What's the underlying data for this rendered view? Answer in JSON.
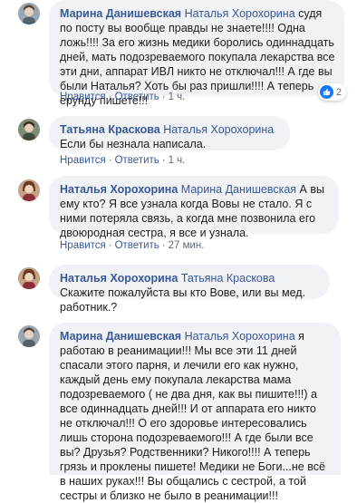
{
  "actions": {
    "like": "Нравится",
    "reply": "Ответить",
    "dot": "·"
  },
  "comments": [
    {
      "author": "Марина Данишевская",
      "mention": "Наталья Хорохорина",
      "text": " судя по посту вы вообще правды не знаете!!!! Одна ложь!!!! За его жизнь медики боролись одиннадцать дней, мать подозреваемого покупала лекарства все эти дни, аппарат ИВЛ никто не отключал!!! А где вы были Наталья? Хоть бы раз пришли!!!! А теперь ерунду пишете!!!",
      "time": "1 ч.",
      "reactions_count": "2",
      "avatar_color": "#8a9ba8"
    },
    {
      "author": "Татьяна Краскова",
      "mention": "Наталья Хорохорина",
      "text": " Если бы незнала написала.",
      "time": "1 ч.",
      "avatar_color": "#6f7f6a"
    },
    {
      "author": "Наталья Хорохорина",
      "mention": "Марина Данишевская",
      "text": " А вы ему кто? Я все узнала когда Вовы не стало. Я с ними потеряла связь, а когда мне позвонила его двоюродная сестра, я все и узнала.",
      "time": "27 мин.",
      "avatar_color": "#a3744f"
    },
    {
      "author": "Наталья Хорохорина",
      "mention": "Татьяна Краскова",
      "text": " Скажите пожалуйста вы кто Вове, или вы мед. работник.?",
      "time": "",
      "avatar_color": "#a3744f"
    },
    {
      "author": "Марина Данишевская",
      "mention": "Наталья Хорохорина",
      "text": " я работаю в реанимации!!! Мы все эти 11 дней спасали этого парня, и лечили его как нужно, каждый день ему покупала лекарства мама подозреваемого ( не два дня, как вы пишите!!!) а все одиннадцать дней!!! И от аппарата его никто не отключал!!! О его здоровье интересовались лишь сторона подозреваемого!!! А где были все вы? Друзья? Родственники? Никого!!!! А теперь грязь и проклены пишете! Медики не Боги...не всё в наших руках!!! Вы общались с сестрой, а той сестры и близко не было в реанимации!!!",
      "time": "",
      "avatar_color": "#8a9ba8"
    }
  ]
}
